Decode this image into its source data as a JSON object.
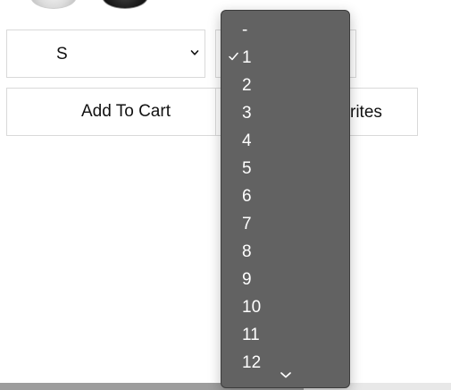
{
  "color_swatches": [
    {
      "name": "light-swatch",
      "color": "#d9d9d9"
    },
    {
      "name": "dark-swatch",
      "color": "#1a1a1a"
    }
  ],
  "size_select": {
    "value": "S",
    "icon": "chevron-down-icon"
  },
  "quantity_select": {
    "value": "1",
    "icon": "chevron-down-icon"
  },
  "buttons": {
    "add_to_cart": "Add To Cart",
    "favorites_visible": "rites"
  },
  "quantity_dropdown": {
    "selected": "1",
    "check_icon": "checkmark-icon",
    "scroll_icon": "chevron-down-icon",
    "options": [
      "-",
      "1",
      "2",
      "3",
      "4",
      "5",
      "6",
      "7",
      "8",
      "9",
      "10",
      "11",
      "12"
    ]
  },
  "colors": {
    "dropdown_bg": "#626262",
    "dropdown_text": "#ffffff",
    "border": "#d9d9d9"
  }
}
